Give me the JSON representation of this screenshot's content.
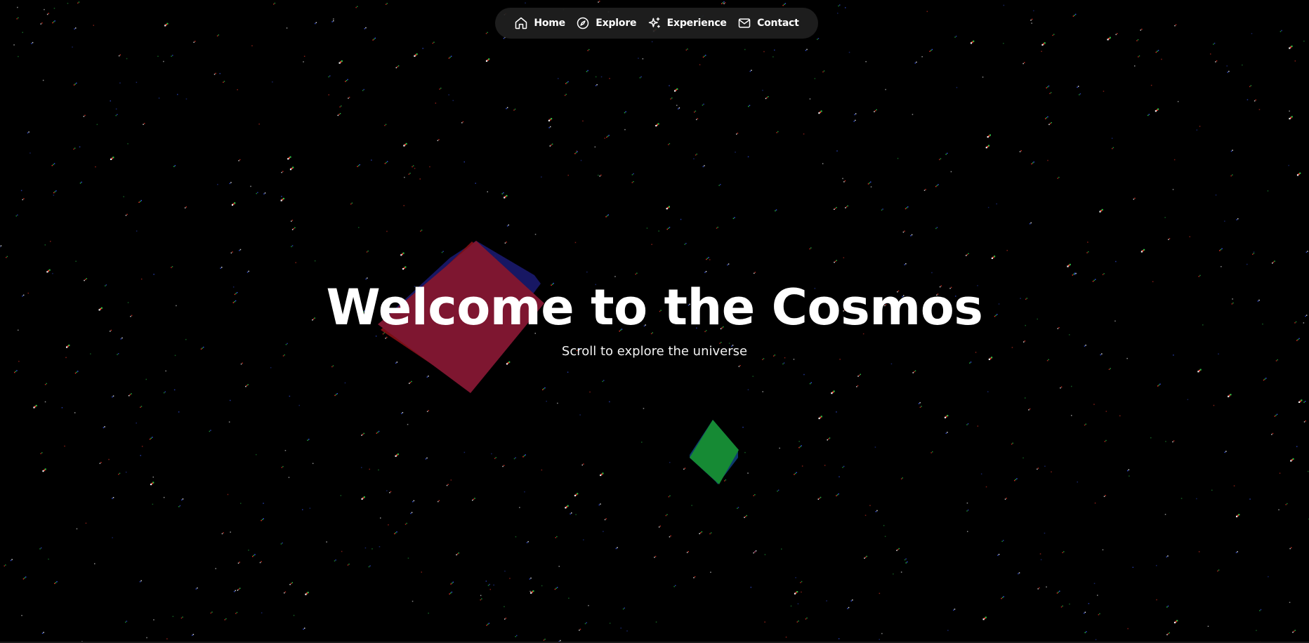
{
  "nav": {
    "items": [
      {
        "label": "Home",
        "icon": "home-icon"
      },
      {
        "label": "Explore",
        "icon": "compass-icon"
      },
      {
        "label": "Experience",
        "icon": "sparkles-icon"
      },
      {
        "label": "Contact",
        "icon": "mail-icon"
      }
    ]
  },
  "hero": {
    "title": "Welcome to the Cosmos",
    "subtitle": "Scroll to explore the universe"
  },
  "scene": {
    "background": "#000000",
    "shapes": [
      {
        "name": "red-cube",
        "color": "#7e1630"
      },
      {
        "name": "green-cube",
        "color": "#168a34"
      }
    ]
  }
}
